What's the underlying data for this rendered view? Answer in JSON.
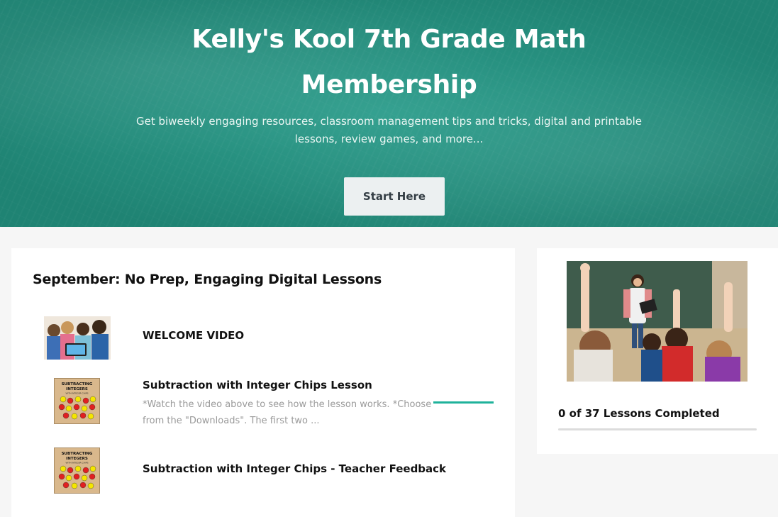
{
  "hero": {
    "title": "Kelly's Kool 7th Grade Math Membership",
    "subtitle": "Get biweekly engaging resources, classroom management tips and tricks, digital and printable lessons, review games, and more...",
    "cta_label": "Start Here"
  },
  "section": {
    "title": "September: No Prep, Engaging Digital Lessons"
  },
  "lessons": [
    {
      "title": "WELCOME VIDEO",
      "excerpt": ""
    },
    {
      "title": "Subtraction with Integer Chips Lesson",
      "excerpt": "*Watch the video above to see how the lesson works. *Choose from the \"Downloads\".  The first two ..."
    },
    {
      "title": "Subtraction with Integer Chips - Teacher Feedback",
      "excerpt": ""
    }
  ],
  "thumbnail_text": {
    "line1": "SUBTRACTING",
    "line2": "INTEGERS",
    "line3": "WITH INTEGER CHIPS"
  },
  "sidebar": {
    "completed_text": "0 of 37 Lessons Completed",
    "completed_count": 0,
    "total_lessons": 37
  },
  "colors": {
    "hero_bg": "#2a9584",
    "accent": "#1fb29b",
    "button_bg": "#ecf0f1"
  }
}
